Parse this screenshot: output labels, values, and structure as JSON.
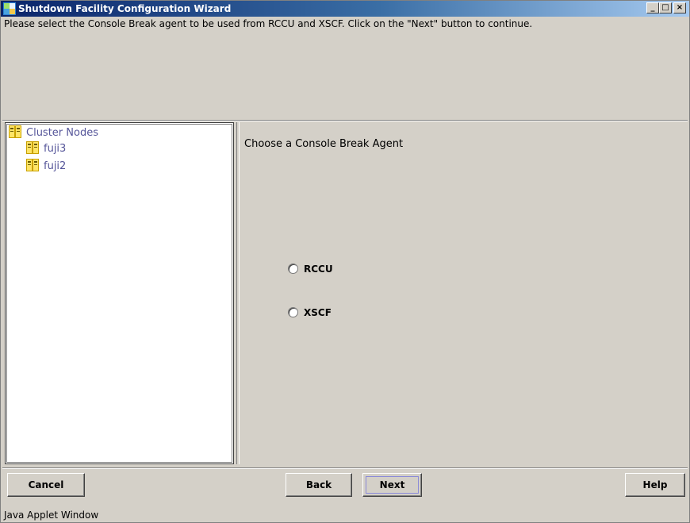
{
  "window": {
    "title": "Shutdown Facility Configuration Wizard",
    "controls": {
      "minimize": "_",
      "maximize": "□",
      "close": "×"
    }
  },
  "instruction": "Please select the Console Break agent to be used from RCCU and XSCF. Click on the \"Next\" button to continue.",
  "tree": {
    "root": {
      "label": "Cluster Nodes",
      "icon": "cluster-nodes-icon"
    },
    "children": [
      {
        "label": "fuji3",
        "icon": "node-icon"
      },
      {
        "label": "fuji2",
        "icon": "node-icon"
      }
    ]
  },
  "main": {
    "heading": "Choose a Console Break Agent",
    "options": [
      {
        "label": "RCCU",
        "selected": false
      },
      {
        "label": "XSCF",
        "selected": false
      }
    ]
  },
  "buttons": {
    "cancel": "Cancel",
    "back": "Back",
    "next": "Next",
    "help": "Help"
  },
  "status": "Java Applet Window",
  "colors": {
    "title_bar_start": "#0a246a",
    "title_bar_end": "#a6caf0",
    "window_background": "#d4d0c8",
    "tree_text": "#555599"
  }
}
